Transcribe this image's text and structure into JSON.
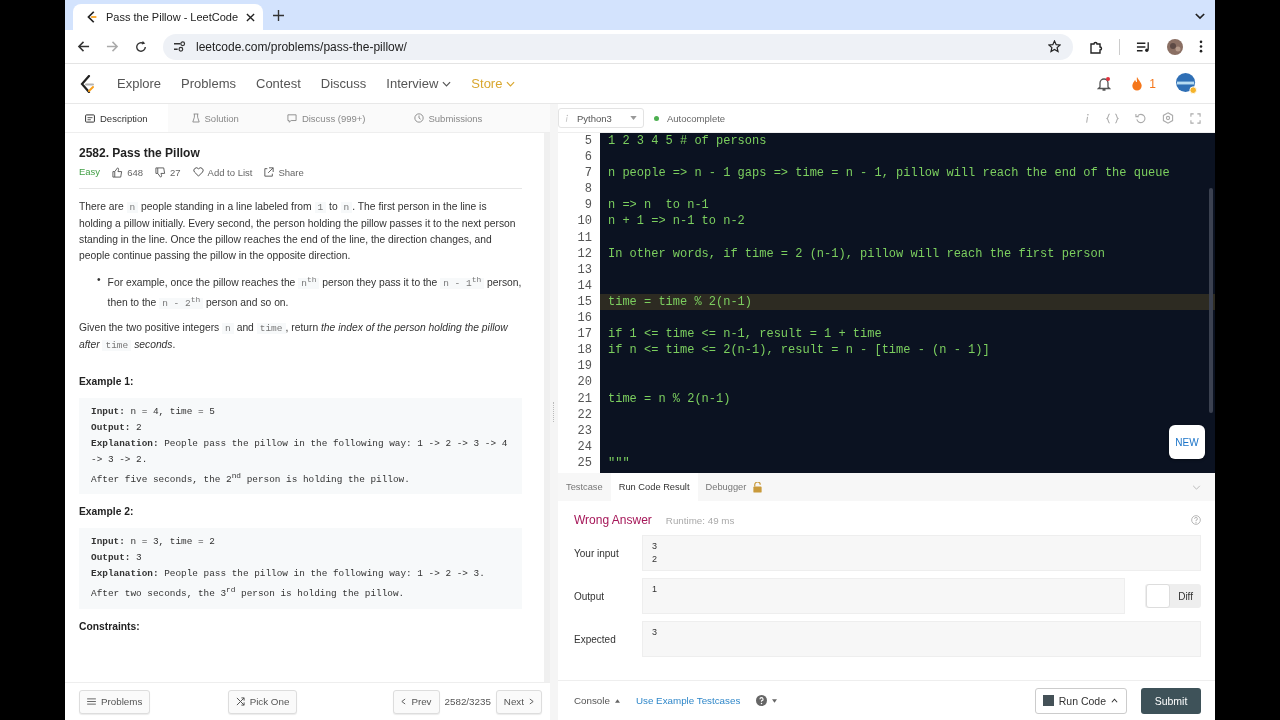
{
  "browser": {
    "tab_title": "Pass the Pillow - LeetCode",
    "url": "leetcode.com/problems/pass-the-pillow/"
  },
  "nav": {
    "items": [
      {
        "label": "Explore",
        "kind": "link"
      },
      {
        "label": "Problems",
        "kind": "link"
      },
      {
        "label": "Contest",
        "kind": "link"
      },
      {
        "label": "Discuss",
        "kind": "link"
      },
      {
        "label": "Interview",
        "kind": "menu"
      },
      {
        "label": "Store",
        "kind": "store"
      }
    ],
    "streak": "1"
  },
  "problem_tabs": [
    {
      "label": "Description",
      "selected": true
    },
    {
      "label": "Solution",
      "selected": false
    },
    {
      "label": "Discuss (999+)",
      "selected": false
    },
    {
      "label": "Submissions",
      "selected": false
    }
  ],
  "problem": {
    "title": "2582. Pass the Pillow",
    "difficulty": "Easy",
    "likes": "648",
    "dislikes": "27",
    "add_to_list": "Add to List",
    "share": "Share",
    "paragraphs": [
      [
        {
          "kind": "text",
          "text": "There are "
        },
        {
          "kind": "code",
          "text": "n"
        },
        {
          "kind": "text",
          "text": " people standing in a line labeled from "
        },
        {
          "kind": "code",
          "text": "1"
        },
        {
          "kind": "text",
          "text": " to "
        },
        {
          "kind": "code",
          "text": "n"
        },
        {
          "kind": "text",
          "text": ". The first person in the line is holding a pillow initially. Every second, the person holding the pillow passes it to the next person standing in the line. Once the pillow reaches the end of the line, the direction changes, and people continue passing the pillow in the opposite direction."
        }
      ]
    ],
    "bullets": [
      {
        "marker": "•",
        "segments": [
          {
            "kind": "text",
            "text": "For example, once the pillow reaches the "
          },
          {
            "kind": "code",
            "text": "n$^{th}$"
          },
          {
            "kind": "text",
            "text": " person they pass it to the "
          },
          {
            "kind": "code",
            "text": "n - 1$^{th}$"
          },
          {
            "kind": "text",
            "text": " person, then to the "
          },
          {
            "kind": "code",
            "text": "n - 2$^{th}$"
          },
          {
            "kind": "text",
            "text": " person and so on."
          }
        ]
      }
    ],
    "task": [
      {
        "kind": "text",
        "text": "Given the two positive integers "
      },
      {
        "kind": "code",
        "text": "n"
      },
      {
        "kind": "text",
        "text": " and "
      },
      {
        "kind": "code",
        "text": "time"
      },
      {
        "kind": "text",
        "text": ", return "
      },
      {
        "kind": "em",
        "text": "the index of the person holding the pillow after "
      },
      {
        "kind": "code",
        "text": "time"
      },
      {
        "kind": "em",
        "text": " seconds"
      },
      {
        "kind": "text",
        "text": "."
      }
    ],
    "examples": [
      {
        "heading": "Example 1:",
        "lines": [
          "**Input:** n = 4, time = 5",
          "**Output:** 2",
          "**Explanation:** People pass the pillow in the following way: 1 -> 2 -> 3 -> 4 -> 3 -> 2.",
          "After five seconds, the 2$^{nd}$ person is holding the pillow."
        ]
      },
      {
        "heading": "Example 2:",
        "lines": [
          "**Input:** n = 3, time = 2",
          "**Output:** 3",
          "**Explanation:** People pass the pillow in the following way: 1 -> 2 -> 3.",
          "After two seconds, the 3$^{rd}$ person is holding the pillow."
        ]
      }
    ],
    "constraints_heading": "Constraints:"
  },
  "left_footer": {
    "problems": "Problems",
    "pick_one": "Pick One",
    "prev": "Prev",
    "position": "2582/3235",
    "next": "Next"
  },
  "editor": {
    "language": "Python3",
    "autocomplete": "Autocomplete",
    "new_badge": "NEW",
    "lines": [
      {
        "num": "5",
        "text": "1 2 3 4 5 # of persons",
        "current": false
      },
      {
        "num": "6",
        "current": false
      },
      {
        "num": "7",
        "text": "n people => n - 1 gaps => time = n - 1, pillow will reach the end of the queue",
        "current": false
      },
      {
        "num": "8",
        "current": false
      },
      {
        "num": "9",
        "text": "n => n  to n-1",
        "current": false
      },
      {
        "num": "10",
        "text": "n + 1 => n-1 to n-2",
        "current": false
      },
      {
        "num": "11",
        "current": false
      },
      {
        "num": "12",
        "text": "In other words, if time = 2 (n-1), pillow will reach the first person",
        "current": false
      },
      {
        "num": "13",
        "current": false
      },
      {
        "num": "14",
        "current": false
      },
      {
        "num": "15",
        "text": "time = time % 2(n-1)",
        "current": true
      },
      {
        "num": "16",
        "current": false
      },
      {
        "num": "17",
        "text": "if 1 <= time <= n-1, result = 1 + time",
        "current": false
      },
      {
        "num": "18",
        "text": "if n <= time <= 2(n-1), result = n - [time - (n - 1)]",
        "current": false
      },
      {
        "num": "19",
        "current": false
      },
      {
        "num": "20",
        "current": false
      },
      {
        "num": "21",
        "text": "time = n % 2(n-1)",
        "current": false
      },
      {
        "num": "22",
        "current": false
      },
      {
        "num": "23",
        "current": false
      },
      {
        "num": "24",
        "current": false
      },
      {
        "num": "25",
        "text": "\"\"\"",
        "current": false
      }
    ]
  },
  "result_tabs": [
    {
      "label": "Testcase",
      "selected": false
    },
    {
      "label": "Run Code Result",
      "selected": true
    },
    {
      "label": "Debugger",
      "selected": false
    }
  ],
  "result": {
    "status": "Wrong Answer",
    "runtime": "Runtime: 49 ms",
    "fields": [
      {
        "label": "Your input",
        "lines": [
          "3",
          "2"
        ]
      },
      {
        "label": "Output",
        "lines": [
          "1"
        ]
      },
      {
        "label": "Expected",
        "lines": [
          "3"
        ]
      }
    ],
    "diff": {
      "label": "Diff",
      "on": false
    }
  },
  "right_footer": {
    "console": "Console",
    "use_example": "Use Example Testcases",
    "run": "Run Code",
    "submit": "Submit"
  }
}
